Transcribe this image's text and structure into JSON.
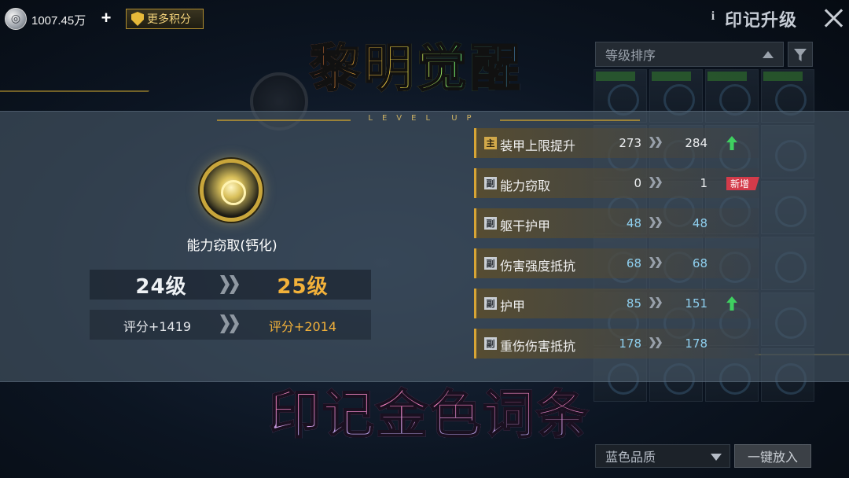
{
  "topbar": {
    "currency_amount": "1007.45万",
    "plus_label": "+",
    "more_points_label": "更多积分",
    "info_label": "i",
    "title": "印记升级"
  },
  "background_panel": {
    "sort_label": "等级排序",
    "quality_label": "蓝色品质",
    "one_key_label": "一键放入"
  },
  "levelup": {
    "banner_text": "LEVEL UP",
    "mark_name": "能力窃取(钙化)",
    "level_old": "24级",
    "level_new": "25级",
    "score_old": "评分+1419",
    "score_new": "评分+2014"
  },
  "attributes": [
    {
      "badge": "主",
      "name": "装甲上限提升",
      "old": "273",
      "new": "284",
      "indicator": "up"
    },
    {
      "badge": "副",
      "name": "能力窃取",
      "old": "0",
      "new": "1",
      "indicator": "new",
      "tag": "新增"
    },
    {
      "badge": "副",
      "name": "躯干护甲",
      "old": "48",
      "new": "48",
      "indicator": "none"
    },
    {
      "badge": "副",
      "name": "伤害强度抵抗",
      "old": "68",
      "new": "68",
      "indicator": "none"
    },
    {
      "badge": "副",
      "name": "护甲",
      "old": "85",
      "new": "151",
      "indicator": "up"
    },
    {
      "badge": "副",
      "name": "重伤伤害抵抗",
      "old": "178",
      "new": "178",
      "indicator": "none"
    }
  ],
  "captions": {
    "top": "黎明觉醒",
    "bottom": "印记金色词条"
  },
  "colors": {
    "accent_gold": "#d7a536",
    "level_new": "#f2b13a",
    "up_green": "#3fd060",
    "new_tag_red": "#d33b4a",
    "secondary_value_blue": "#8fd0f0"
  }
}
